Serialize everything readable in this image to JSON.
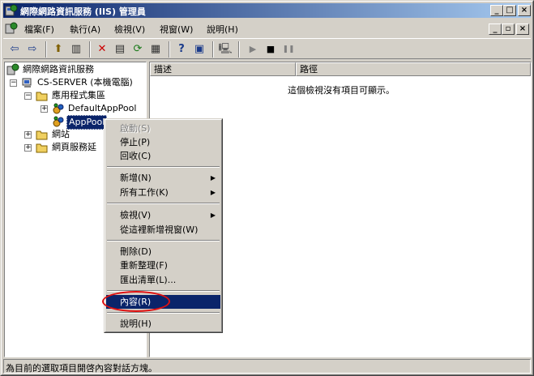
{
  "window": {
    "title": "網際網路資訊服務 (IIS) 管理員",
    "caption_buttons": [
      "_",
      "□",
      "×"
    ]
  },
  "menubar": {
    "items": [
      "檔案(F)",
      "執行(A)",
      "檢視(V)",
      "視窗(W)",
      "說明(H)"
    ],
    "mdi_buttons": [
      "_",
      "▫",
      "×"
    ]
  },
  "toolbar": {
    "buttons": [
      "back-icon",
      "forward-icon",
      "up-folder-icon",
      "show-tree-icon",
      "properties-icon",
      "refresh-icon",
      "export-list-icon",
      "delete-icon",
      "help-icon",
      "console-icon",
      "computer-icon",
      "play-icon",
      "stop-icon",
      "pause-icon"
    ],
    "glyphs": {
      "back": "⇦",
      "forward": "⇨",
      "up": "⬆",
      "tree": "▥",
      "delete": "✕",
      "properties": "▤",
      "refresh": "⟳",
      "export": "▦",
      "help": "?",
      "panel": "▣",
      "computer": "🖳",
      "play": "▶",
      "stop": "■",
      "pause": "❚❚"
    }
  },
  "tree": {
    "root": "網際網路資訊服務",
    "server": "CS-SERVER (本機電腦)",
    "app_pools": "應用程式集區",
    "default_pool": "DefaultAppPool",
    "app_pool": "AppPool",
    "websites": "網站",
    "web_ext": "網頁服務延",
    "expand_plus": "+",
    "expand_minus": "−"
  },
  "list": {
    "columns": [
      "描述",
      "路徑"
    ],
    "empty_message": "這個檢視沒有項目可顯示。"
  },
  "context_menu": {
    "start": "啟動(S)",
    "stop": "停止(P)",
    "recycle": "回收(C)",
    "new": "新增(N)",
    "all_tasks": "所有工作(K)",
    "view": "檢視(V)",
    "new_window": "從這裡新增視窗(W)",
    "delete": "刪除(D)",
    "refresh": "重新整理(F)",
    "export": "匯出清單(L)...",
    "properties": "內容(R)",
    "help": "說明(H)",
    "submenu_arrow": "▶"
  },
  "statusbar": {
    "text": "為目前的選取項目開啓內容對話方塊。"
  },
  "colors": {
    "title_start": "#0a246a",
    "title_end": "#a6caf0",
    "highlight": "#0a246a",
    "annotation": "#e01010",
    "delete_icon": "#cc0000"
  }
}
